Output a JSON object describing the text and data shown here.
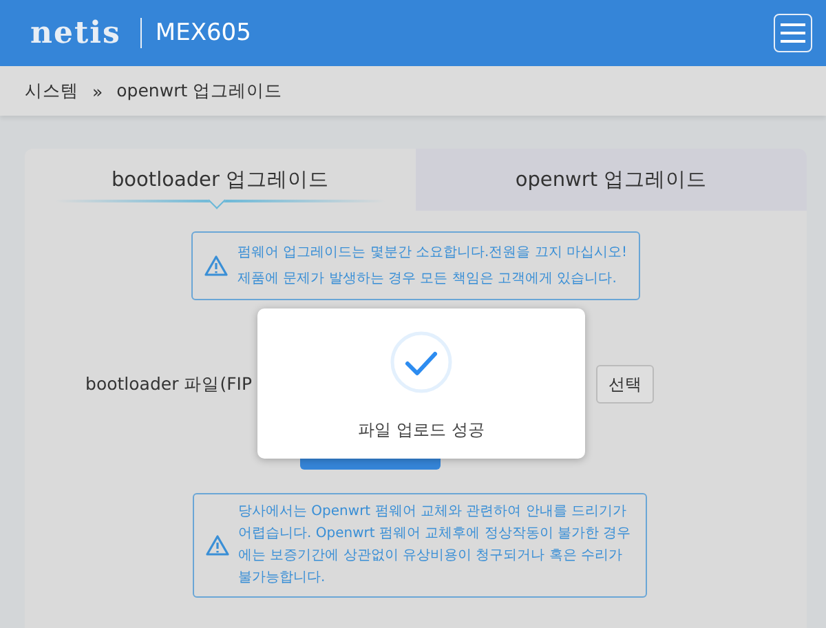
{
  "header": {
    "logo": "netis",
    "model": "MEX605"
  },
  "breadcrumb": {
    "parent": "시스템",
    "separator": "»",
    "current": "openwrt 업그레이드"
  },
  "tabs": [
    {
      "label": "bootloader 업그레이드",
      "selected": true
    },
    {
      "label": "openwrt 업그레이드",
      "selected": false
    }
  ],
  "warning_top": {
    "lines": [
      "펌웨어 업그레이드는 몇분간 소요합니다.전원을 끄지 마십시오!",
      "제품에 문제가 발생하는 경우 모든 책임은 고객에게 있습니다."
    ]
  },
  "file_row": {
    "label": "bootloader 파일(FIP",
    "choose_button": "선택"
  },
  "warning_bottom": {
    "text": "당사에서는 Openwrt 펌웨어 교체와 관련하여 안내를 드리기가 어렵습니다. Openwrt 펌웨어 교체후에 정상작동이 불가한 경우에는 보증기간에 상관없이 유상비용이 청구되거나 혹은 수리가 불가능합니다."
  },
  "dialog": {
    "message": "파일 업로드 성공"
  }
}
